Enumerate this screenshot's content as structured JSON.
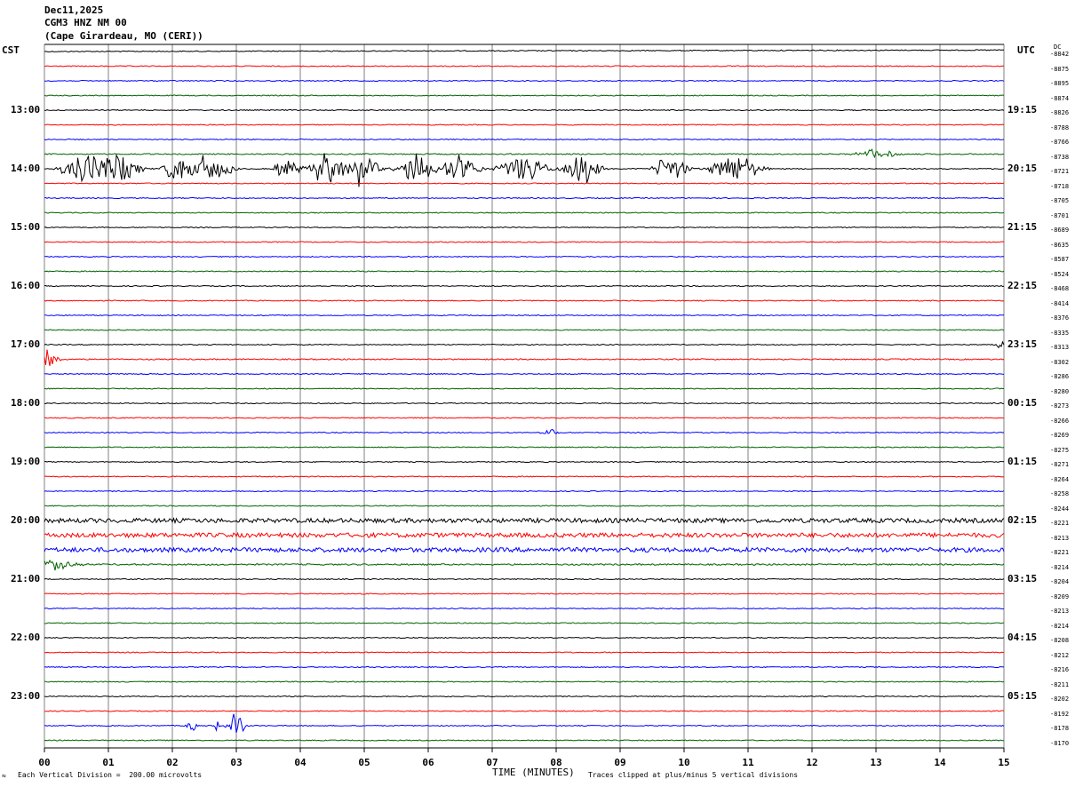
{
  "header": {
    "date": "Dec11,2025",
    "station": "CGM3 HNZ NM 00",
    "location": "(Cape Girardeau, MO (CERI))"
  },
  "left_zone": "CST",
  "right_zone": "UTC",
  "dc_label": "DC",
  "footer": {
    "xlabel": "TIME (MINUTES)",
    "scale_note": "Each Vertical Division =  200.00 microvolts",
    "clip_note": "Traces clipped at plus/minus 5 vertical divisions",
    "logo_char": "≈"
  },
  "colors": {
    "trace_cycle": [
      "#000000",
      "#ff0000",
      "#0000ff",
      "#006400"
    ],
    "grid": "#808080"
  },
  "chart_data": {
    "type": "line",
    "title": "Dec11,2025 CGM3 HNZ NM 00 (Cape Girardeau, MO (CERI))",
    "xlabel": "TIME (MINUTES)",
    "xlim": [
      0,
      15
    ],
    "x_ticks": [
      "00",
      "01",
      "02",
      "03",
      "04",
      "05",
      "06",
      "07",
      "08",
      "09",
      "10",
      "11",
      "12",
      "13",
      "14",
      "15"
    ],
    "minutes_per_line": 15,
    "grid": true,
    "left_hour_labels": [
      "13:00",
      "14:00",
      "15:00",
      "16:00",
      "17:00",
      "18:00",
      "19:00",
      "20:00",
      "21:00",
      "22:00",
      "23:00"
    ],
    "right_hour_labels": [
      "19:15",
      "20:15",
      "21:15",
      "22:15",
      "23:15",
      "00:15",
      "01:15",
      "02:15",
      "03:15",
      "04:15",
      "05:15"
    ],
    "hour_label_first_line": 4,
    "hour_label_every": 4,
    "dc_offsets": [
      "-8842",
      "-8875",
      "-8895",
      "-8874",
      "-8826",
      "-8788",
      "-8766",
      "-8738",
      "-8721",
      "-8718",
      "-8705",
      "-8701",
      "-8689",
      "-8635",
      "-8587",
      "-8524",
      "-8468",
      "-8414",
      "-8376",
      "-8335",
      "-8313",
      "-8302",
      "-8286",
      "-8280",
      "-8273",
      "-8266",
      "-8269",
      "-8275",
      "-8271",
      "-8264",
      "-8258",
      "-8244",
      "-8221",
      "-8213",
      "-8221",
      "-8214",
      "-8204",
      "-8209",
      "-8213",
      "-8214",
      "-8208",
      "-8212",
      "-8216",
      "-8211",
      "-8202",
      "-8192",
      "-8178",
      "-8170"
    ],
    "trace_activity": [
      1,
      1,
      1,
      1,
      1,
      1,
      1,
      1.2,
      1,
      1,
      1,
      1,
      1,
      1,
      1,
      1,
      1,
      1,
      1,
      1,
      1,
      1.2,
      1,
      1,
      1,
      1,
      1,
      1,
      1,
      1,
      1,
      1,
      4.5,
      4.5,
      4.5,
      1.5,
      1,
      1,
      1,
      1,
      1,
      1,
      1,
      1,
      1,
      1,
      1,
      1
    ],
    "events": [
      {
        "line": 8,
        "bursts": [
          [
            0.6,
            0.5
          ],
          [
            1.1,
            0.6
          ],
          [
            2.1,
            0.35
          ],
          [
            2.6,
            0.5
          ],
          [
            3.8,
            0.3
          ],
          [
            4.4,
            0.4
          ],
          [
            4.9,
            0.5
          ],
          [
            5.8,
            0.45
          ],
          [
            6.5,
            0.5
          ],
          [
            7.5,
            0.6
          ],
          [
            8.4,
            0.45
          ],
          [
            9.8,
            0.4
          ],
          [
            10.8,
            0.6
          ]
        ],
        "amp": 16
      },
      {
        "line": 7,
        "bursts": [
          [
            13.0,
            0.5
          ]
        ],
        "amp": 5
      },
      {
        "line": 20,
        "bursts": [
          [
            14.95,
            0.1
          ]
        ],
        "amp": 8
      },
      {
        "line": 21,
        "bursts": [
          [
            0.05,
            0.3
          ]
        ],
        "amp": 9
      },
      {
        "line": 26,
        "bursts": [
          [
            7.9,
            0.2
          ]
        ],
        "amp": 4
      },
      {
        "line": 35,
        "bursts": [
          [
            0.2,
            0.5
          ]
        ],
        "amp": 6
      },
      {
        "line": 46,
        "bursts": [
          [
            2.3,
            0.1
          ],
          [
            2.7,
            0.05
          ],
          [
            3.0,
            0.2
          ]
        ],
        "amp": 14
      }
    ]
  }
}
